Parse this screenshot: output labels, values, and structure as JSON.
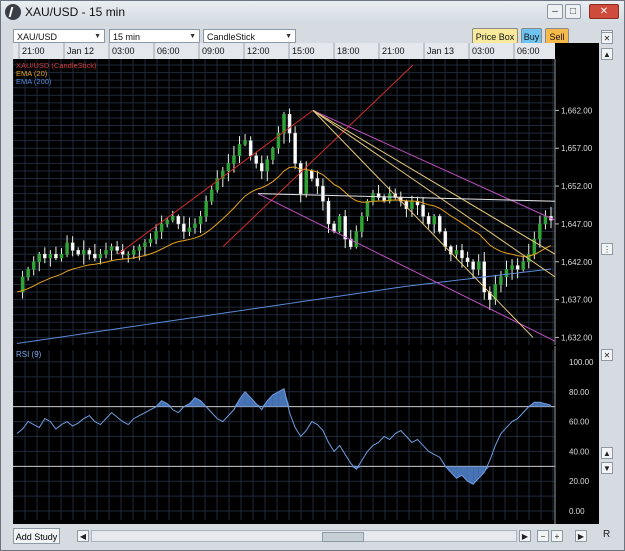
{
  "window": {
    "title": "XAU/USD - 15 min",
    "controls": [
      "–",
      "□",
      "✕"
    ]
  },
  "toolbar": {
    "symbol": "XAU/USD",
    "timeframe": "15 min",
    "chart_style": "CandleStick",
    "price_box_label": "Price Box",
    "buy_label": "Buy",
    "sell_label": "Sell",
    "buy_color": "#6ec3f0",
    "sell_color": "#f7b94a",
    "price_box_color": "#f8ea9a"
  },
  "legend": [
    {
      "text": "XAU/USD (CandleStick)",
      "color": "#d23b3b"
    },
    {
      "text": "EMA (20)",
      "color": "#e8a21c"
    },
    {
      "text": "EMA (200)",
      "color": "#5a8ad8"
    }
  ],
  "rsi_label": "RSI (9)",
  "bottom": {
    "add_study_label": "Add Study",
    "right_label": "R"
  },
  "icons": {
    "app": "chart-app-icon",
    "side": [
      "close-icon",
      "up-arrow-icon",
      "grip-icon",
      "down-arrow-icon"
    ],
    "scroll": [
      "scroll-left-icon",
      "scroll-right-icon",
      "minus-icon",
      "plus-icon"
    ]
  },
  "chart_data": [
    {
      "type": "candlestick",
      "title": "XAU/USD",
      "x_tick_labels": [
        "21:00",
        "Jan 12",
        "03:00",
        "06:00",
        "09:00",
        "12:00",
        "15:00",
        "18:00",
        "21:00",
        "Jan 13",
        "03:00",
        "06:00"
      ],
      "ylim": [
        1631,
        1668
      ],
      "y_ticks": [
        "1,632.00",
        "1,637.00",
        "1,642.00",
        "1,647.00",
        "1,652.00",
        "1,657.00",
        "1,662.00"
      ],
      "series": [
        {
          "name": "XAU/USD (CandleStick)",
          "color": "#d23b3b"
        },
        {
          "name": "EMA (20)",
          "color": "#e8a21c"
        },
        {
          "name": "EMA (200)",
          "color": "#5a8ad8"
        }
      ],
      "close_path": [
        1638,
        1640,
        1641,
        1642,
        1643,
        1642.5,
        1643,
        1642.5,
        1643,
        1644.5,
        1643.5,
        1643,
        1643.5,
        1643,
        1642.5,
        1643,
        1643.5,
        1644,
        1643.5,
        1643,
        1643,
        1643.5,
        1644,
        1644.5,
        1645,
        1646,
        1647,
        1647.5,
        1648,
        1647,
        1646,
        1646.5,
        1647,
        1648,
        1650,
        1651.5,
        1653,
        1654,
        1655,
        1656,
        1657.5,
        1658,
        1656,
        1655,
        1654,
        1655.5,
        1657,
        1659,
        1661.5,
        1659,
        1655,
        1651,
        1654,
        1653,
        1652,
        1650,
        1647,
        1646,
        1648,
        1645,
        1644,
        1646,
        1648,
        1650,
        1651,
        1650.5,
        1650,
        1651,
        1650.5,
        1650,
        1649,
        1650,
        1649.5,
        1648,
        1647,
        1648,
        1646,
        1644,
        1643,
        1643.5,
        1642.5,
        1642,
        1641,
        1642,
        1638,
        1637,
        1639,
        1640,
        1641,
        1641.5,
        1641,
        1642,
        1643,
        1645,
        1647,
        1648,
        1647.5
      ]
    },
    {
      "type": "line",
      "title": "RSI (9)",
      "ylim": [
        -6,
        108
      ],
      "y_ticks": [
        "0.00",
        "20.00",
        "40.00",
        "60.00",
        "80.00",
        "100.00"
      ],
      "levels": [
        30,
        70
      ],
      "values": [
        52,
        55,
        60,
        58,
        56,
        62,
        60,
        55,
        58,
        60,
        57,
        59,
        62,
        64,
        60,
        58,
        62,
        66,
        63,
        60,
        58,
        62,
        64,
        66,
        68,
        70,
        74,
        72,
        68,
        66,
        70,
        72,
        76,
        74,
        70,
        66,
        62,
        60,
        64,
        68,
        75,
        80,
        76,
        72,
        68,
        74,
        78,
        80,
        82,
        66,
        56,
        50,
        54,
        60,
        58,
        54,
        46,
        40,
        44,
        38,
        32,
        28,
        34,
        40,
        44,
        46,
        50,
        48,
        52,
        54,
        50,
        46,
        48,
        44,
        40,
        38,
        36,
        30,
        26,
        22,
        24,
        20,
        18,
        22,
        26,
        34,
        44,
        52,
        56,
        60,
        62,
        66,
        70,
        73,
        73,
        72,
        71
      ]
    }
  ]
}
